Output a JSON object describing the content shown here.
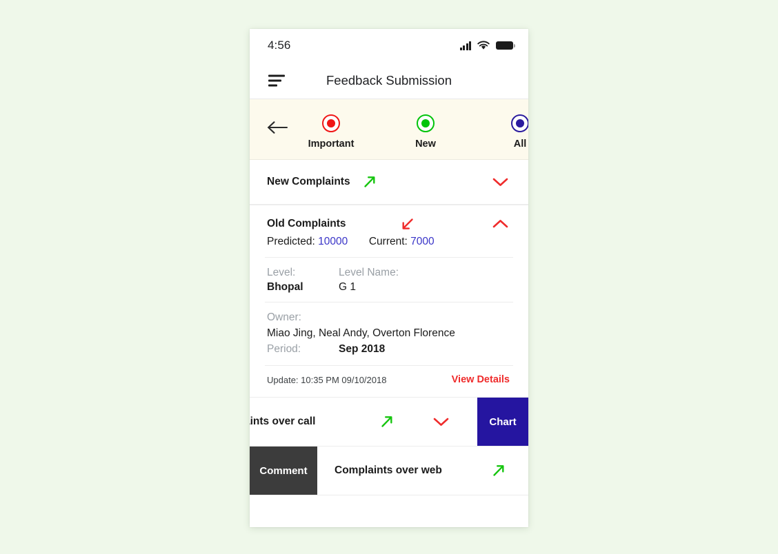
{
  "theme": {
    "page_background": "#eff8ea",
    "accent_red": "#ef2b2b",
    "accent_green": "#16c50f",
    "accent_indigo": "#2515a0",
    "value_blue": "#3a35c8",
    "segment_background": "#fdfaed",
    "comment_action_background": "#3c3c3c"
  },
  "status_bar": {
    "time": "4:56",
    "signal_icon": "cellular-signal-icon",
    "wifi_icon": "wifi-icon",
    "battery_icon": "battery-full-icon"
  },
  "app_bar": {
    "menu_icon": "hamburger-menu-icon",
    "title": "Feedback Submission"
  },
  "segment_bar": {
    "back_icon": "back-arrow-icon",
    "items": [
      {
        "label": "Important",
        "color": "#f01616",
        "icon": "radio-selected-icon"
      },
      {
        "label": "New",
        "color": "#00c40a",
        "icon": "radio-selected-icon"
      },
      {
        "label": "All",
        "color": "#2a1a9e",
        "icon": "radio-selected-icon"
      }
    ]
  },
  "list": {
    "new_complaints": {
      "title": "New Complaints",
      "trend_icon": "arrow-up-right-icon",
      "trend_direction": "up",
      "chevron_icon": "chevron-down-icon",
      "expanded": false
    },
    "old_complaints": {
      "title": "Old Complaints",
      "trend_icon": "arrow-down-left-icon",
      "trend_direction": "down",
      "chevron_icon": "chevron-up-icon",
      "expanded": true,
      "metrics": {
        "predicted_label": "Predicted:",
        "predicted_value": "10000",
        "current_label": "Current:",
        "current_value": "7000"
      },
      "details": {
        "level_label": "Level:",
        "level_value": "Bhopal",
        "level_name_label": "Level Name:",
        "level_name_value": "G 1",
        "owner_label": "Owner:",
        "owner_value": "Miao Jing, Neal Andy, Overton Florence",
        "period_label": "Period:",
        "period_value": "Sep 2018"
      },
      "footer": {
        "update_text": "Update: 10:35 PM 09/10/2018",
        "view_details_label": "View Details"
      }
    },
    "complaints_over_call": {
      "title": "aints over call",
      "full_title": "Complaints over call",
      "trend_icon": "arrow-up-right-icon",
      "chevron_icon": "chevron-down-icon",
      "swipe_state": "revealed-right",
      "action_label": "Chart"
    },
    "complaints_over_web": {
      "title": "Complaints over web",
      "trend_icon": "arrow-up-right-icon",
      "swipe_state": "revealed-left",
      "action_label": "Comment"
    }
  }
}
